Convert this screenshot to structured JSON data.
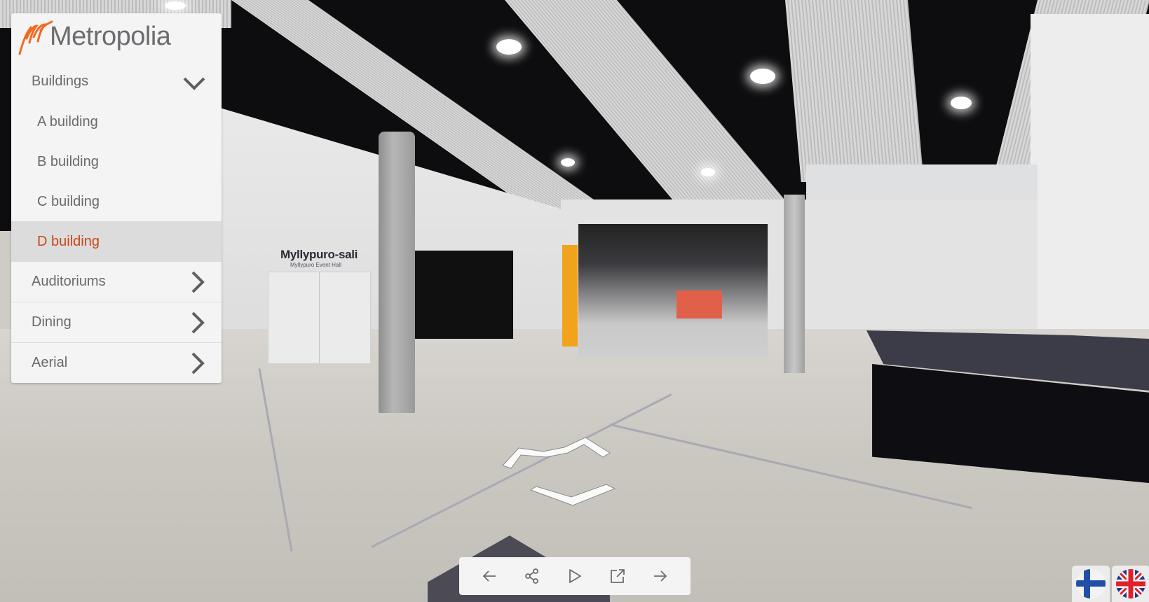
{
  "app": {
    "brand": "Metropolia",
    "brand_color": "#f26a21",
    "accent_color": "#c8471a"
  },
  "menu": {
    "sections": [
      {
        "label": "Buildings",
        "expanded": true,
        "icon": "chevron-down-icon",
        "items": [
          {
            "label": "A building",
            "active": false
          },
          {
            "label": "B building",
            "active": false
          },
          {
            "label": "C building",
            "active": false
          },
          {
            "label": "D building",
            "active": true
          }
        ]
      },
      {
        "label": "Auditoriums",
        "expanded": false,
        "icon": "chevron-right-icon"
      },
      {
        "label": "Dining",
        "expanded": false,
        "icon": "chevron-right-icon"
      },
      {
        "label": "Aerial",
        "expanded": false,
        "icon": "chevron-right-icon"
      }
    ]
  },
  "toolbar": {
    "buttons": [
      {
        "name": "previous",
        "icon": "arrow-left-icon",
        "title": "Previous"
      },
      {
        "name": "share",
        "icon": "share-icon",
        "title": "Share"
      },
      {
        "name": "play",
        "icon": "play-icon",
        "title": "Play"
      },
      {
        "name": "open-external",
        "icon": "external-link-icon",
        "title": "Open"
      },
      {
        "name": "next",
        "icon": "arrow-right-icon",
        "title": "Next"
      }
    ]
  },
  "languages": [
    {
      "code": "fi",
      "label": "Suomi",
      "icon": "finland-flag-icon"
    },
    {
      "code": "en",
      "label": "English",
      "icon": "uk-flag-icon"
    }
  ],
  "scene": {
    "sign_title": "Myllypuro-sali",
    "sign_subtitle": "Myllypuro Event Hall"
  }
}
